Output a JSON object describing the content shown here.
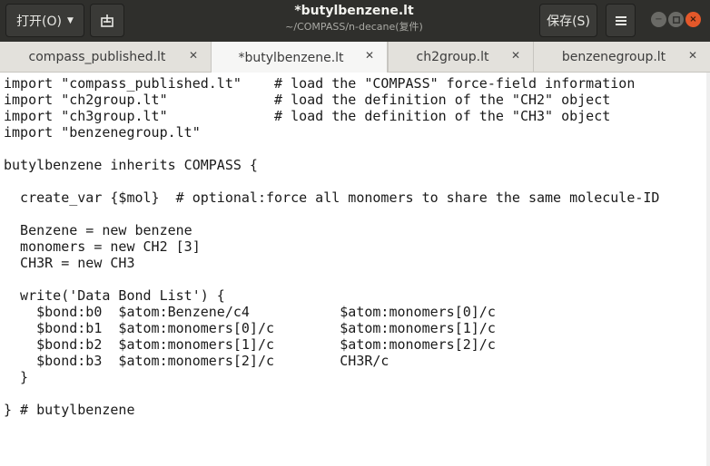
{
  "window": {
    "title": "*butylbenzene.lt",
    "subtitle": "~/COMPASS/n-decane(复件)"
  },
  "header": {
    "open_label": "打开(O)",
    "open_icon": "chevron-down-icon",
    "new_icon": "new-document-icon",
    "save_label": "保存(S)",
    "menu_icon": "hamburger-menu-icon"
  },
  "tabs": [
    {
      "label": "compass_published.lt",
      "active": false
    },
    {
      "label": "*butylbenzene.lt",
      "active": true
    },
    {
      "label": "ch2group.lt",
      "active": false
    },
    {
      "label": "benzenegroup.lt",
      "active": false
    }
  ],
  "editor": {
    "lines": [
      "import \"compass_published.lt\"    # load the \"COMPASS\" force-field information",
      "import \"ch2group.lt\"             # load the definition of the \"CH2\" object",
      "import \"ch3group.lt\"             # load the definition of the \"CH3\" object",
      "import \"benzenegroup.lt\"",
      "",
      "butylbenzene inherits COMPASS {",
      "",
      "  create_var {$mol}  # optional:force all monomers to share the same molecule-ID",
      "",
      "  Benzene = new benzene",
      "  monomers = new CH2 [3]",
      "  CH3R = new CH3",
      "",
      "  write('Data Bond List') {",
      "    $bond:b0  $atom:Benzene/c4           $atom:monomers[0]/c",
      "    $bond:b1  $atom:monomers[0]/c        $atom:monomers[1]/c",
      "    $bond:b2  $atom:monomers[1]/c        $atom:monomers[2]/c",
      "    $bond:b3  $atom:monomers[2]/c        CH3R/c",
      "  }",
      "",
      "} # butylbenzene"
    ]
  }
}
